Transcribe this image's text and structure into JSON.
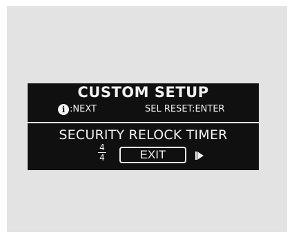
{
  "screen": {
    "title": "CUSTOM SETUP",
    "hint_next_icon": "i",
    "hint_next": ":NEXT",
    "hint_reset": "SEL RESET:ENTER",
    "item_title": "SECURITY RELOCK TIMER",
    "page_current": "4",
    "page_total": "4",
    "option_value": "EXIT"
  },
  "icons": {
    "info": "info-icon",
    "next": "right-arrow-icon"
  },
  "colors": {
    "lcd_background": "#101010",
    "lcd_text": "#f2f2f2",
    "panel_background": "#e3e3e3"
  }
}
